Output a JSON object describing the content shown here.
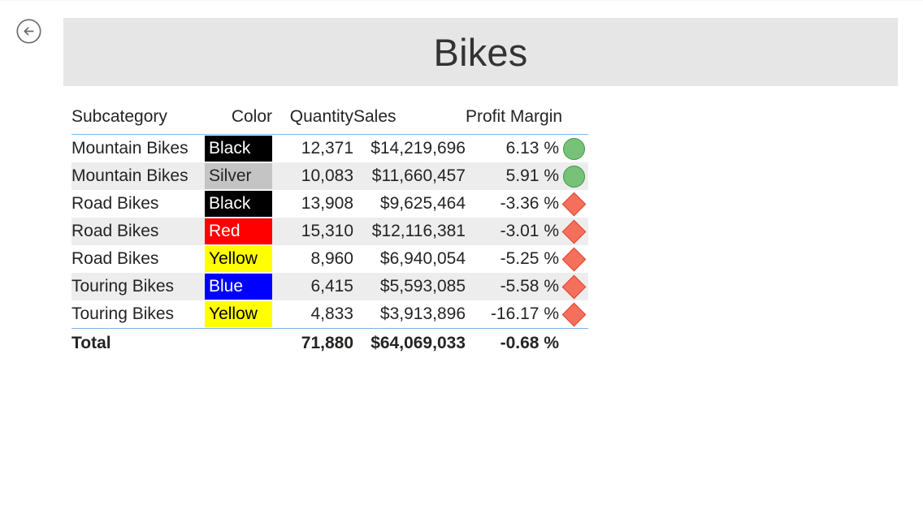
{
  "nav": {
    "back_button_label": "Back",
    "back_icon": "circled-left-arrow-icon"
  },
  "header": {
    "title": "Bikes",
    "background_color": "#e6e6e6"
  },
  "table": {
    "columns": [
      {
        "key": "subcategory",
        "label": "Subcategory",
        "align": "left"
      },
      {
        "key": "color",
        "label": "Color",
        "align": "right"
      },
      {
        "key": "quantity",
        "label": "Quantity",
        "align": "right"
      },
      {
        "key": "sales",
        "label": "Sales",
        "align": "left"
      },
      {
        "key": "profit_margin",
        "label": "Profit Margin",
        "align": "right"
      }
    ],
    "rows": [
      {
        "subcategory": "Mountain Bikes",
        "color": "Black",
        "color_bg": "#000000",
        "color_fg": "#ffffff",
        "quantity": "12,371",
        "sales": "$14,219,696",
        "profit_margin": "6.13 %",
        "kpi": "circle-green"
      },
      {
        "subcategory": "Mountain Bikes",
        "color": "Silver",
        "color_bg": "#c4c4c4",
        "color_fg": "#252423",
        "quantity": "10,083",
        "sales": "$11,660,457",
        "profit_margin": "5.91 %",
        "kpi": "circle-green"
      },
      {
        "subcategory": "Road Bikes",
        "color": "Black",
        "color_bg": "#000000",
        "color_fg": "#ffffff",
        "quantity": "13,908",
        "sales": "$9,625,464",
        "profit_margin": "-3.36 %",
        "kpi": "diamond-red"
      },
      {
        "subcategory": "Road Bikes",
        "color": "Red",
        "color_bg": "#ff0000",
        "color_fg": "#ffffff",
        "quantity": "15,310",
        "sales": "$12,116,381",
        "profit_margin": "-3.01 %",
        "kpi": "diamond-red"
      },
      {
        "subcategory": "Road Bikes",
        "color": "Yellow",
        "color_bg": "#ffff00",
        "color_fg": "#000000",
        "quantity": "8,960",
        "sales": "$6,940,054",
        "profit_margin": "-5.25 %",
        "kpi": "diamond-red"
      },
      {
        "subcategory": "Touring Bikes",
        "color": "Blue",
        "color_bg": "#0000ff",
        "color_fg": "#ffffff",
        "quantity": "6,415",
        "sales": "$5,593,085",
        "profit_margin": "-5.58 %",
        "kpi": "diamond-red"
      },
      {
        "subcategory": "Touring Bikes",
        "color": "Yellow",
        "color_bg": "#ffff00",
        "color_fg": "#000000",
        "quantity": "4,833",
        "sales": "$3,913,896",
        "profit_margin": "-16.17 %",
        "kpi": "diamond-red"
      }
    ],
    "total": {
      "subcategory": "Total",
      "color": "",
      "quantity": "71,880",
      "sales": "$64,069,033",
      "profit_margin": "-0.68 %",
      "kpi": ""
    },
    "styles": {
      "band_color": "#ededed",
      "rule_color": "#7ab6e8",
      "kpi_good_fill": "#77c278",
      "kpi_good_stroke": "#3c9a40",
      "kpi_bad_fill": "#f4705c",
      "kpi_bad_stroke": "#e0452c"
    }
  }
}
